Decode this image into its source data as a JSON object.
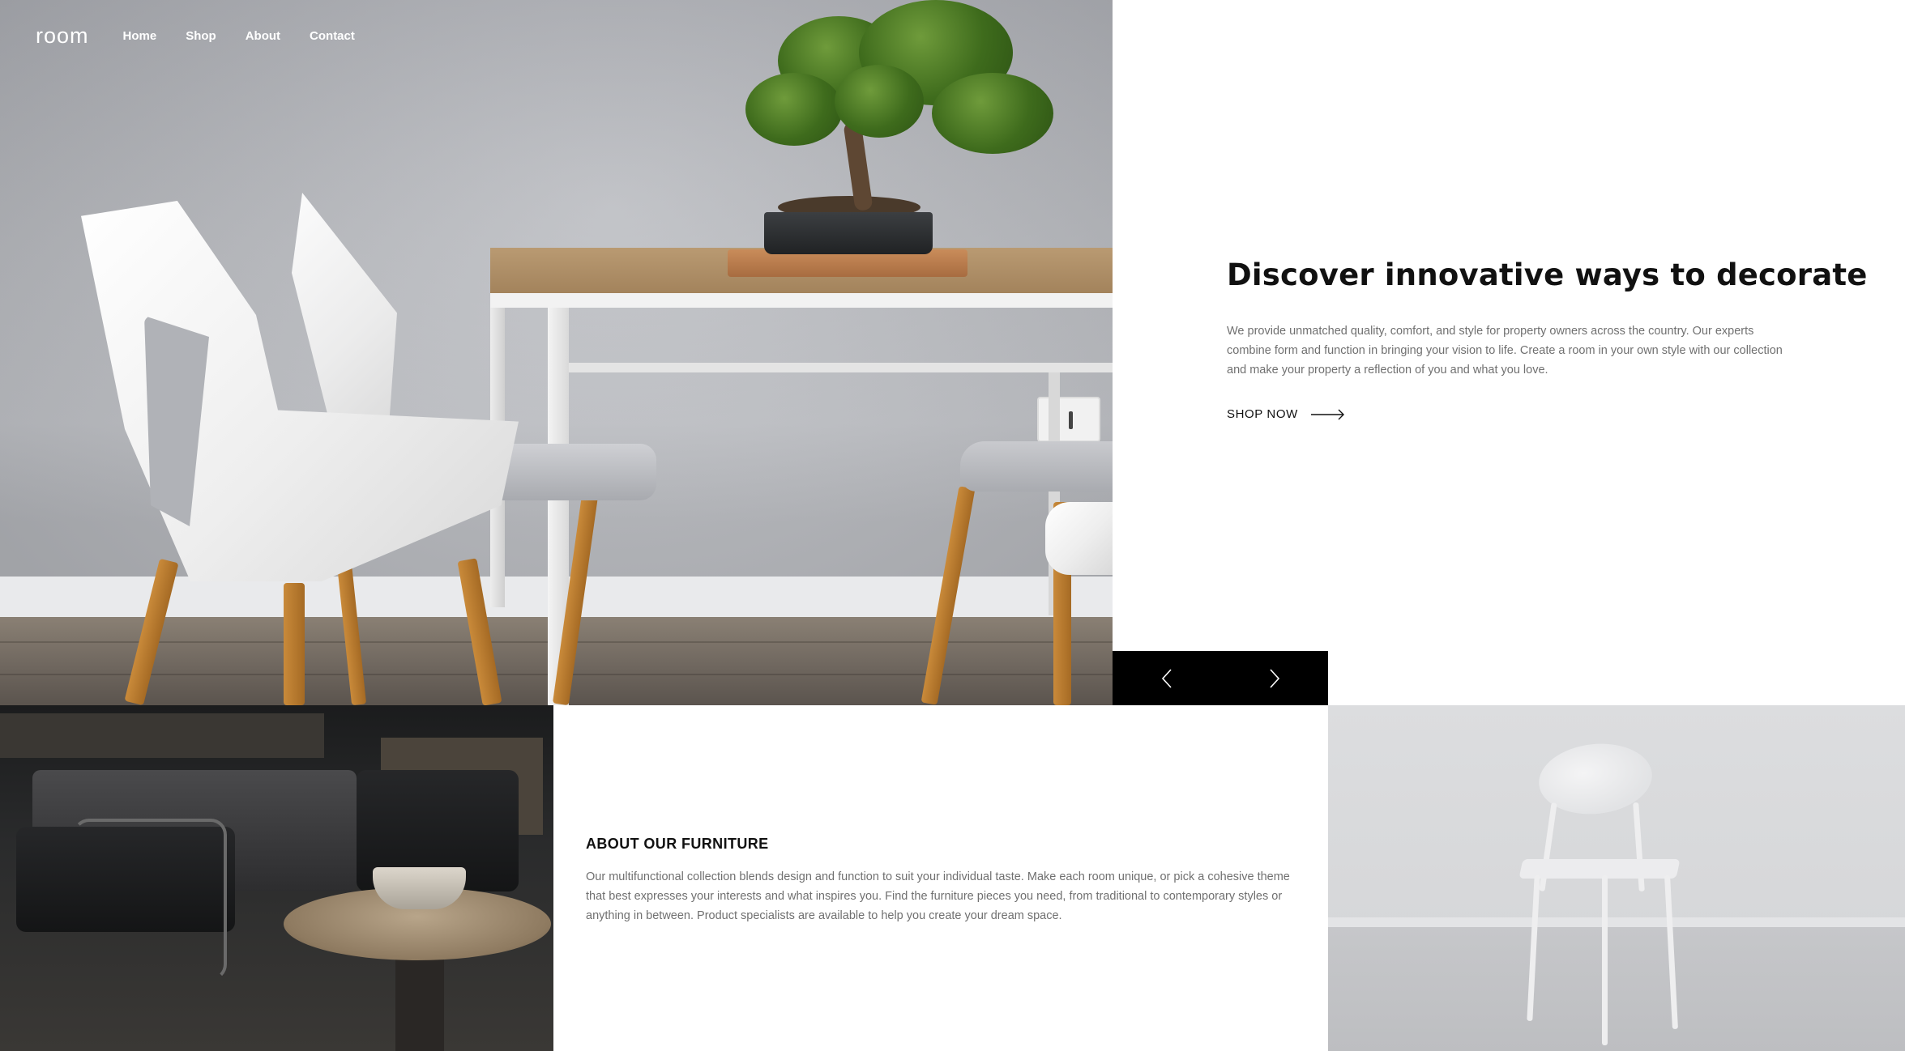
{
  "nav": {
    "logo": "room",
    "links": [
      "Home",
      "Shop",
      "About",
      "Contact"
    ]
  },
  "hero": {
    "title": "Discover innovative ways to decorate",
    "description": "We provide unmatched quality, comfort, and style for property owners across the country. Our experts combine form and function in bringing your vision to life. Create a room in your own style with our collection and make your property a reflection of you and what you love.",
    "cta_label": "SHOP NOW",
    "cta_icon": "arrow-right-icon"
  },
  "slider": {
    "prev_icon": "chevron-left-icon",
    "next_icon": "chevron-right-icon",
    "background": "#000000"
  },
  "about": {
    "title": "ABOUT OUR FURNITURE",
    "description": "Our multifunctional collection blends design and function to suit your individual taste. Make each room unique, or pick a cohesive theme that best expresses your interests and what inspires you. Find the furniture pieces you need, from traditional to contemporary styles or anything in between. Product specialists are available to help you create your dream space."
  },
  "colors": {
    "text_dark": "#111111",
    "text_muted": "#707070",
    "nav_text": "#ffffff",
    "page_bg": "#ffffff"
  }
}
